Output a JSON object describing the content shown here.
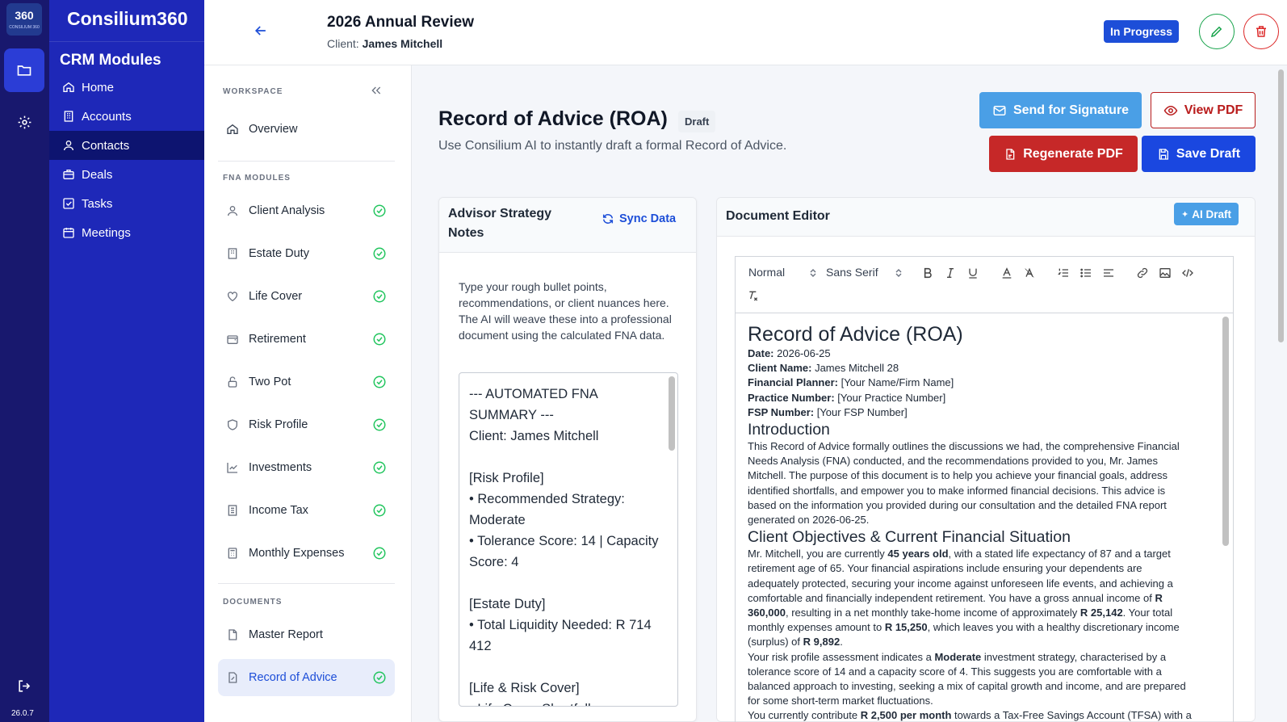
{
  "rail": {
    "logo_text": "360",
    "logo_sub": "CONSILIUM 360",
    "version": "26.0.7"
  },
  "crm": {
    "brand": "Consilium360",
    "heading": "CRM Modules",
    "items": [
      {
        "label": "Home",
        "icon": "home-icon"
      },
      {
        "label": "Accounts",
        "icon": "building-icon"
      },
      {
        "label": "Contacts",
        "icon": "user-icon"
      },
      {
        "label": "Deals",
        "icon": "briefcase-icon"
      },
      {
        "label": "Tasks",
        "icon": "check-square-icon"
      },
      {
        "label": "Meetings",
        "icon": "calendar-icon"
      }
    ]
  },
  "header": {
    "title": "2026 Annual Review",
    "client_label": "Client:",
    "client_name": "James Mitchell",
    "status": "In Progress"
  },
  "workspace": {
    "section_workspace": "WORKSPACE",
    "overview": "Overview",
    "section_fna": "FNA MODULES",
    "fna_items": [
      "Client Analysis",
      "Estate Duty",
      "Life Cover",
      "Retirement",
      "Two Pot",
      "Risk Profile",
      "Investments",
      "Income Tax",
      "Monthly Expenses"
    ],
    "section_documents": "DOCUMENTS",
    "doc_items": [
      "Master Report",
      "Record of Advice"
    ]
  },
  "main": {
    "title": "Record of Advice (ROA)",
    "badge": "Draft",
    "subtitle": "Use Consilium AI to instantly draft a formal Record of Advice.",
    "btn_sign": "Send for Signature",
    "btn_view": "View PDF",
    "btn_regen": "Regenerate PDF",
    "btn_save": "Save Draft"
  },
  "notes": {
    "title": "Advisor Strategy Notes",
    "sync": "Sync Data",
    "help": "Type your rough bullet points, recommendations, or client nuances here. The AI will weave these into a professional document using the calculated FNA data.",
    "content": "--- AUTOMATED FNA SUMMARY ---\nClient: James Mitchell\n\n[Risk Profile]\n• Recommended Strategy: Moderate\n• Tolerance Score: 14 | Capacity Score: 4\n\n[Estate Duty]\n• Total Liquidity Needed: R 714 412\n\n[Life & Risk Cover]\n• Life Cover Shortfall"
  },
  "editor": {
    "title": "Document Editor",
    "ai_draft": "AI Draft",
    "toolbar": {
      "heading_select": "Normal",
      "font_select": "Sans Serif"
    },
    "doc": {
      "title": "Record of Advice (ROA)",
      "meta": [
        {
          "k": "Date:",
          "v": " 2026-06-25"
        },
        {
          "k": "Client Name:",
          "v": " James Mitchell 28"
        },
        {
          "k": "Financial Planner:",
          "v": " [Your Name/Firm Name]"
        },
        {
          "k": "Practice Number:",
          "v": " [Your Practice Number]"
        },
        {
          "k": "FSP Number:",
          "v": " [Your FSP Number]"
        }
      ],
      "h_intro": "Introduction",
      "p_intro": "This Record of Advice formally outlines the discussions we had, the comprehensive Financial Needs Analysis (FNA) conducted, and the recommendations provided to you, Mr. James Mitchell. The purpose of this document is to help you achieve your financial goals, address identified shortfalls, and empower you to make informed financial decisions. This advice is based on the information you provided during our consultation and the detailed FNA report generated on 2026-06-25.",
      "h_obj": "Client Objectives & Current Financial Situation",
      "p_obj": [
        {
          "t": "Mr. Mitchell, you are currently "
        },
        {
          "b": "45 years old"
        },
        {
          "t": ", with a stated life expectancy of 87 and a target retirement age of 65. Your financial aspirations include ensuring your dependents are adequately protected, securing your income against unforeseen life events, and achieving a comfortable and financially independent retirement. You have a gross annual income of "
        },
        {
          "b": "R 360,000"
        },
        {
          "t": ", resulting in a net monthly take-home income of approximately "
        },
        {
          "b": "R 25,142"
        },
        {
          "t": ". Your total monthly expenses amount to "
        },
        {
          "b": "R 15,250"
        },
        {
          "t": ", which leaves you with a healthy discretionary income (surplus) of "
        },
        {
          "b": "R 9,892"
        },
        {
          "t": "."
        }
      ],
      "p_risk": [
        {
          "t": "Your risk profile assessment indicates a "
        },
        {
          "b": "Moderate"
        },
        {
          "t": " investment strategy, characterised by a tolerance score of 14 and a capacity score of 4. This suggests you are comfortable with a balanced approach to investing, seeking a mix of capital growth and income, and are prepared for some short-term market fluctuations."
        }
      ],
      "p_tfsa": [
        {
          "t": "You currently contribute "
        },
        {
          "b": "R 2,500 per month"
        },
        {
          "t": " towards a Tax-Free Savings Account (TFSA) with a"
        }
      ]
    }
  },
  "colors": {
    "rail": "#18186e",
    "crm": "#1e28b8",
    "primary": "#1a47e0",
    "danger": "#c62828",
    "accent_light": "#4a9fe6",
    "success": "#16a34a"
  }
}
